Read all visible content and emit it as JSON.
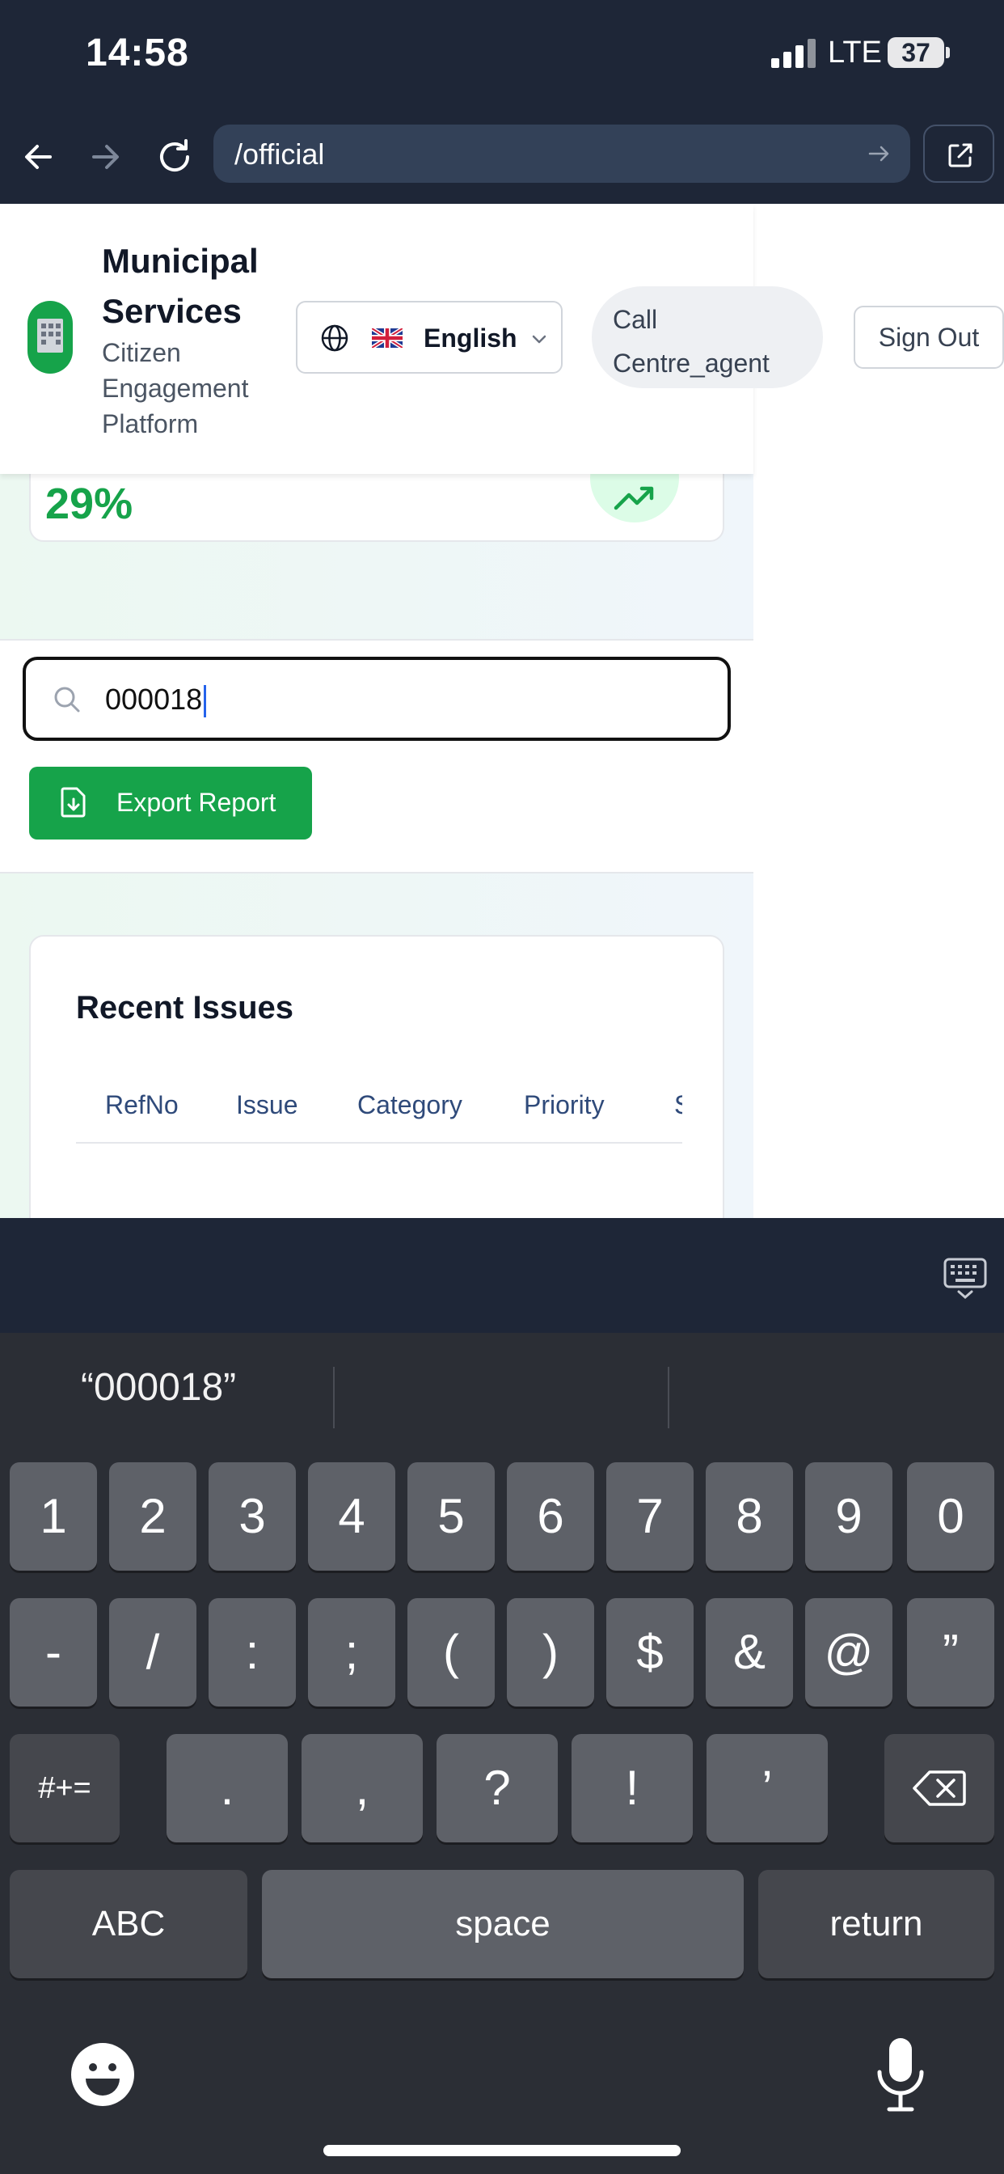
{
  "status_bar": {
    "time": "14:58",
    "network": "LTE",
    "battery": "37"
  },
  "browser": {
    "url": "/official"
  },
  "header": {
    "brand_title": "Municipal Services",
    "brand_subtitle": "Citizen Engagement Platform",
    "language": "English",
    "role": "Call Centre_agent",
    "signout": "Sign Out"
  },
  "stat": {
    "value": "29%"
  },
  "search": {
    "value": "000018"
  },
  "export": {
    "label": "Export Report"
  },
  "issues": {
    "title": "Recent Issues",
    "columns": [
      "RefNo",
      "Issue",
      "Category",
      "Priority",
      "S"
    ]
  },
  "keyboard": {
    "prediction": "“000018”",
    "row1": [
      "1",
      "2",
      "3",
      "4",
      "5",
      "6",
      "7",
      "8",
      "9",
      "0"
    ],
    "row2": [
      "-",
      "/",
      ":",
      ";",
      "(",
      ")",
      "$",
      "&",
      "@",
      "”"
    ],
    "row3": [
      ".",
      ",",
      "?",
      "!",
      "’"
    ],
    "shift_label": "#+=",
    "abc_label": "ABC",
    "space_label": "space",
    "return_label": "return"
  }
}
